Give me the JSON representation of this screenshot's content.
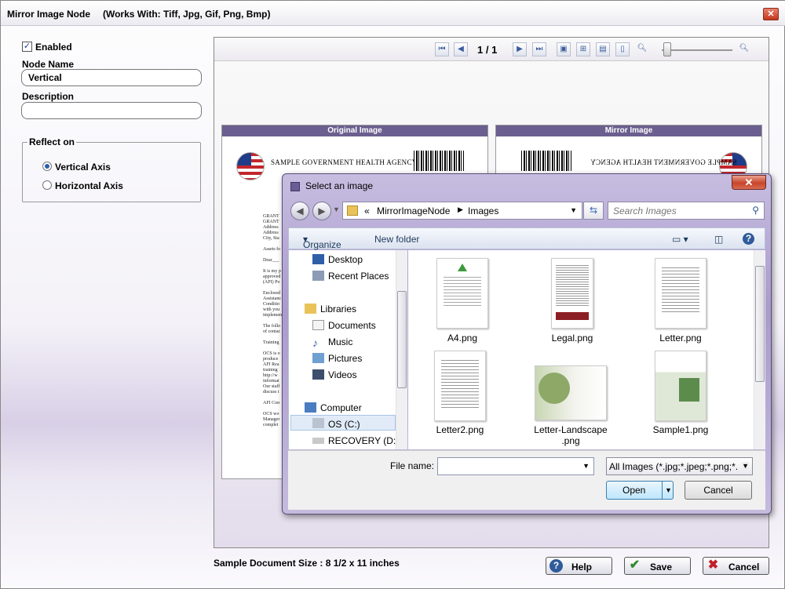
{
  "window": {
    "title": "Mirror Image Node",
    "subtitle": "(Works With: Tiff, Jpg, Gif, Png, Bmp)",
    "close_glyph": "✕"
  },
  "form": {
    "enabled_label": "Enabled",
    "enabled_checked": true,
    "node_name_label": "Node Name",
    "node_name_value": "Vertical",
    "description_label": "Description",
    "description_value": "",
    "reflect_on_label": "Reflect on",
    "vertical_axis_label": "Vertical Axis",
    "horizontal_axis_label": "Horizontal Axis",
    "selected_axis": "Vertical Axis"
  },
  "viewer": {
    "page_current": "1",
    "page_sep": "/",
    "page_total": "1",
    "original_header": "Original Image",
    "mirror_header": "Mirror Image",
    "agency_text": "SAMPLE GOVERNMENT HEALTH AGENCY",
    "doc_lines": [
      "GRANT",
      "GRANT",
      "Address",
      "Address",
      "City, Sta",
      "",
      "Assets fo",
      "",
      "Dear___",
      "",
      "It is my p",
      "approved",
      "(AFI) Po",
      "",
      "Enclosed",
      "Assistanc",
      "Conditio",
      "with you",
      "implemen",
      "",
      "The follo",
      "of contac",
      "",
      "Training",
      "",
      "OCS is o",
      "produce",
      "AFI Rea",
      "training",
      "http://w",
      "informat",
      "Our staff",
      "discuss t",
      "",
      "AFI Con",
      "",
      "OCS wo",
      "Manager",
      "complet"
    ]
  },
  "footer": {
    "doc_size_label": "Sample Document Size : 8 1/2 x 11 inches",
    "help_label": "Help",
    "save_label": "Save",
    "cancel_label": "Cancel"
  },
  "dialog": {
    "title": "Select an image",
    "close_glyph": "✕",
    "path_prefix": "«",
    "path_parts": [
      "MirrorImageNode",
      "Images"
    ],
    "search_placeholder": "Search Images",
    "organize_label": "Organize",
    "new_folder_label": "New folder",
    "nav_items": [
      {
        "label": "Desktop"
      },
      {
        "label": "Recent Places"
      },
      {
        "label": "Libraries"
      },
      {
        "label": "Documents"
      },
      {
        "label": "Music"
      },
      {
        "label": "Pictures"
      },
      {
        "label": "Videos"
      },
      {
        "label": "Computer"
      },
      {
        "label": "OS (C:)"
      },
      {
        "label": "RECOVERY (D:)"
      }
    ],
    "files": [
      {
        "name": "A4.png"
      },
      {
        "name": "Legal.png"
      },
      {
        "name": "Letter.png"
      },
      {
        "name": "Letter2.png"
      },
      {
        "name": "Letter-Landscape",
        "name2": ".png"
      },
      {
        "name": "Sample1.png"
      }
    ],
    "file_name_label": "File name:",
    "file_name_value": "",
    "filter_value": "All Images (*.jpg;*.jpeg;*.png;*.",
    "open_label": "Open",
    "cancel_label": "Cancel"
  },
  "colors": {
    "header_purple": "#6a5f8e",
    "cancel_red": "#c0202a",
    "save_green": "#2e8b2e",
    "help_blue": "#2f5b9a"
  }
}
